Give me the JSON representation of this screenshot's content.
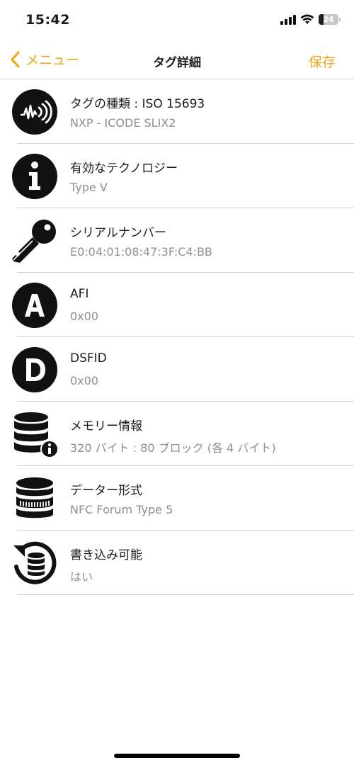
{
  "status": {
    "time": "15:42",
    "battery": "24",
    "battery_level": 0.24
  },
  "nav": {
    "back_label": "メニュー",
    "title": "タグ詳細",
    "save_label": "保存"
  },
  "rows": [
    {
      "icon": "nfc-signal-icon",
      "title": "タグの種類 : ISO 15693",
      "subtitle": "NXP - ICODE SLIX2"
    },
    {
      "icon": "info-icon",
      "title": "有効なテクノロジー",
      "subtitle": "Type V"
    },
    {
      "icon": "key-icon",
      "title": "シリアルナンバー",
      "subtitle": "E0:04:01:08:47:3F:C4:BB"
    },
    {
      "icon": "letter-a-icon",
      "title": "AFI",
      "subtitle": "0x00"
    },
    {
      "icon": "letter-d-icon",
      "title": "DSFID",
      "subtitle": "0x00"
    },
    {
      "icon": "database-info-icon",
      "title": "メモリー情報",
      "subtitle": "320 バイト : 80 ブロック (各 4 バイト)"
    },
    {
      "icon": "data-format-icon",
      "title": "データー形式",
      "subtitle": "NFC Forum Type 5"
    },
    {
      "icon": "writable-icon",
      "title": "書き込み可能",
      "subtitle": "はい"
    }
  ],
  "colors": {
    "accent": "#f2a419",
    "text": "#1c1c1e",
    "secondary": "#8e8e93",
    "separator": "#d1d1d6"
  }
}
